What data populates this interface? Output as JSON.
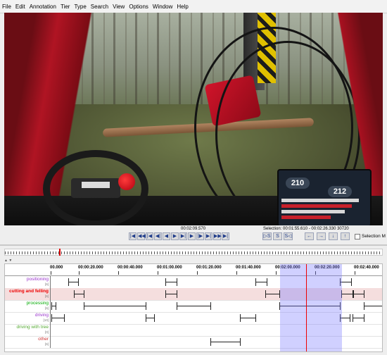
{
  "menubar": {
    "items": [
      "File",
      "Edit",
      "Annotation",
      "Tier",
      "Type",
      "Search",
      "View",
      "Options",
      "Window",
      "Help"
    ]
  },
  "video": {
    "display_left": "210",
    "display_right": "212"
  },
  "player": {
    "current_time": "00:02:09.570",
    "selection_text": "Selection: 00:01:55.610 - 00:02:26.330  30720",
    "selection_mode_label": "Selection M",
    "buttons": [
      {
        "name": "go-to-begin-button",
        "glyph": "|◀"
      },
      {
        "name": "prev-second-button",
        "glyph": "◀◀"
      },
      {
        "name": "prev-frame-button",
        "glyph": "|◀"
      },
      {
        "name": "prev-ms-button",
        "glyph": "◀|"
      },
      {
        "name": "prev-step-button",
        "glyph": "◀"
      },
      {
        "name": "play-button",
        "glyph": "▶"
      },
      {
        "name": "play-selection-button",
        "glyph": "▶|"
      },
      {
        "name": "next-step-button",
        "glyph": "▶"
      },
      {
        "name": "next-ms-button",
        "glyph": "|▶"
      },
      {
        "name": "next-frame-button",
        "glyph": "▶|"
      },
      {
        "name": "next-second-button",
        "glyph": "▶▶"
      },
      {
        "name": "go-to-end-button",
        "glyph": "▶|"
      },
      {
        "name": "selection-begin-button",
        "glyph": "▷S"
      },
      {
        "name": "clear-selection-button",
        "glyph": "S"
      },
      {
        "name": "selection-end-button",
        "glyph": "S◁"
      },
      {
        "name": "left-arrow-button",
        "glyph": "←"
      },
      {
        "name": "right-arrow-button",
        "glyph": "→"
      },
      {
        "name": "down-arrow-button",
        "glyph": "↓"
      },
      {
        "name": "up-arrow-button",
        "glyph": "↑"
      }
    ]
  },
  "timeline": {
    "ticks": [
      "00.000",
      "00:00:20.000",
      "00:00:40.000",
      "00:01:00.000",
      "00:01:20.000",
      "00:01:40.000",
      "00:02:00.000",
      "00:02:20.000",
      "00:02:40.000"
    ],
    "tiers": [
      {
        "name": "positioning",
        "count": "[6]",
        "color": "#9933cc"
      },
      {
        "name": "cutting and felling",
        "count": "[6]",
        "color": "#ee0000"
      },
      {
        "name": "processing",
        "count": "[6]",
        "color": "#00aa00"
      },
      {
        "name": "driving",
        "count": "[10]",
        "color": "#9933cc"
      },
      {
        "name": "driving with tree",
        "count": "[0]",
        "color": "#55aa33"
      },
      {
        "name": "other",
        "count": "[6]",
        "color": "#cc3333"
      }
    ]
  },
  "colors": {
    "selection": "#7878ff",
    "cursor": "#ee0000",
    "highlight_row": "#f5dede"
  }
}
